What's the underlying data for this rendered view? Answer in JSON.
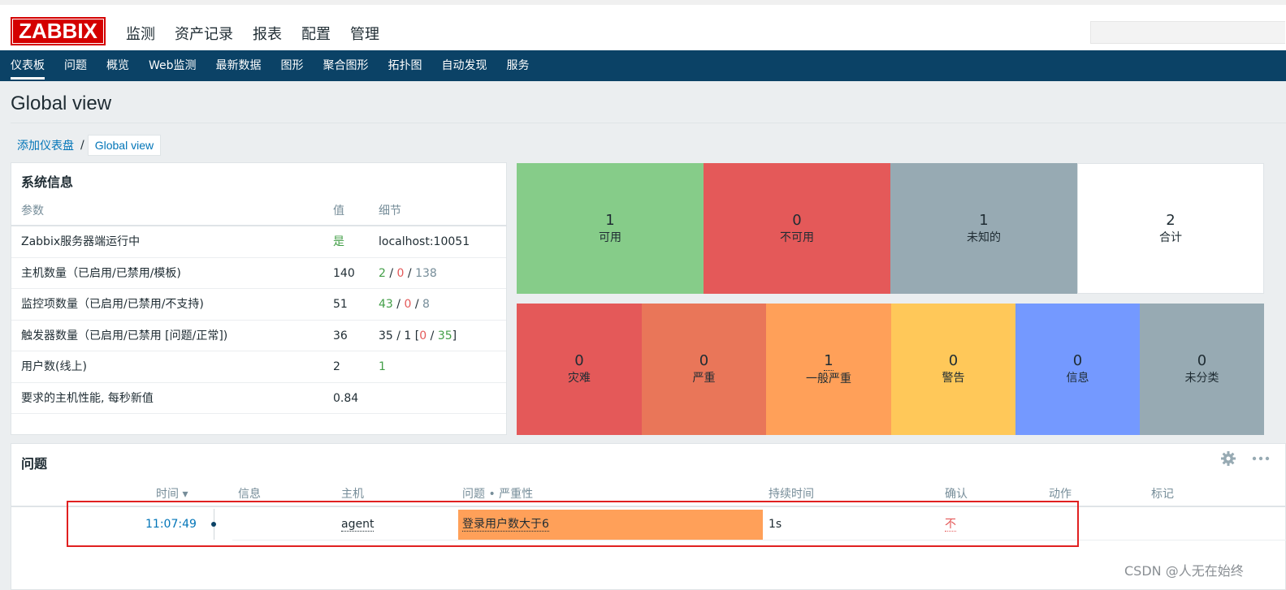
{
  "header": {
    "logo": "ZABBIX",
    "nav": [
      "监测",
      "资产记录",
      "报表",
      "配置",
      "管理"
    ],
    "active_nav": 0
  },
  "subnav": {
    "items": [
      "仪表板",
      "问题",
      "概览",
      "Web监测",
      "最新数据",
      "图形",
      "聚合图形",
      "拓扑图",
      "自动发现",
      "服务"
    ],
    "active": 0
  },
  "page": {
    "title": "Global view",
    "breadcrumb": {
      "parent": "添加仪表盘",
      "separator": "/",
      "current": "Global view"
    }
  },
  "sysinfo": {
    "title": "系统信息",
    "headers": {
      "param": "参数",
      "value": "值",
      "detail": "细节"
    },
    "rows": [
      {
        "param": "Zabbix服务器端运行中",
        "value": "是",
        "detail": [
          "localhost:10051"
        ]
      },
      {
        "param": "主机数量（已启用/已禁用/模板)",
        "value": "140",
        "detail": [
          "2",
          " / ",
          "0",
          " / ",
          "138"
        ]
      },
      {
        "param": "监控项数量（已启用/已禁用/不支持)",
        "value": "51",
        "detail": [
          "43",
          " / ",
          "0",
          " / ",
          "8"
        ]
      },
      {
        "param": "触发器数量（已启用/已禁用 [问题/正常])",
        "value": "36",
        "detail": [
          "35 / 1 [",
          "0",
          " / ",
          "35",
          "]"
        ]
      },
      {
        "param": "用户数(线上)",
        "value": "2",
        "detail": [
          "1"
        ]
      },
      {
        "param": "要求的主机性能, 每秒新值",
        "value": "0.84",
        "detail": [
          ""
        ]
      }
    ]
  },
  "host_availability": [
    {
      "count": "1",
      "label": "可用",
      "color": "#86cc89"
    },
    {
      "count": "0",
      "label": "不可用",
      "color": "#e45959"
    },
    {
      "count": "1",
      "label": "未知的",
      "color": "#97aab3"
    },
    {
      "count": "2",
      "label": "合计",
      "color": "#ffffff"
    }
  ],
  "severity": [
    {
      "count": "0",
      "label": "灾难",
      "color": "#e45959"
    },
    {
      "count": "0",
      "label": "严重",
      "color": "#e97659"
    },
    {
      "count": "1",
      "label": "一般严重",
      "color": "#ffa059"
    },
    {
      "count": "0",
      "label": "警告",
      "color": "#ffc859"
    },
    {
      "count": "0",
      "label": "信息",
      "color": "#7499ff"
    },
    {
      "count": "0",
      "label": "未分类",
      "color": "#97aab3"
    }
  ],
  "problems": {
    "title": "问题",
    "headers": {
      "time": "时间 ▾",
      "info": "信息",
      "host": "主机",
      "problem": "问题 • 严重性",
      "duration": "持续时间",
      "ack": "确认",
      "actions": "动作",
      "tags": "标记"
    },
    "rows": [
      {
        "time": "11:07:49",
        "info": "",
        "host": "agent",
        "problem": "登录用户数大于6",
        "duration": "1s",
        "ack": "不"
      }
    ]
  },
  "watermark": "CSDN @人无在始终"
}
